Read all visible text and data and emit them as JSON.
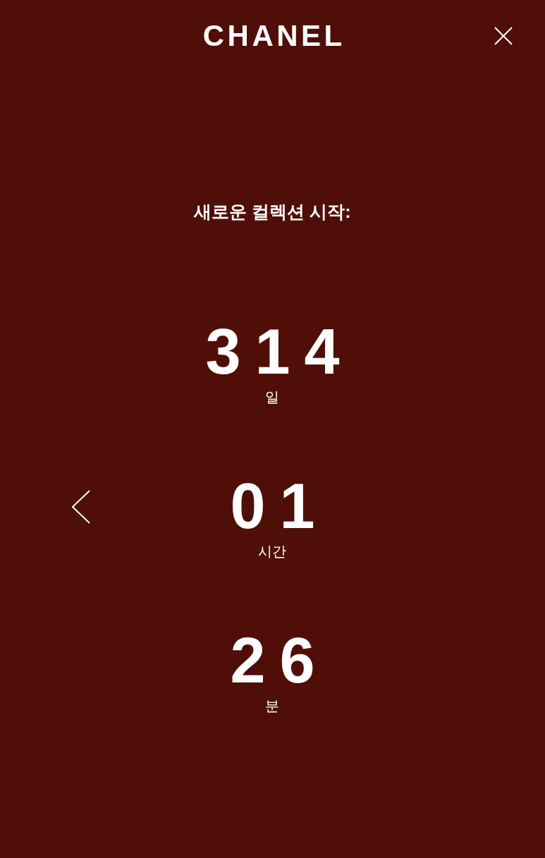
{
  "logo": "CHANEL",
  "headline": "새로운 컬렉션 시작:",
  "countdown": [
    {
      "value": "314",
      "unit": "일"
    },
    {
      "value": "01",
      "unit": "시간"
    },
    {
      "value": "26",
      "unit": "분"
    }
  ]
}
